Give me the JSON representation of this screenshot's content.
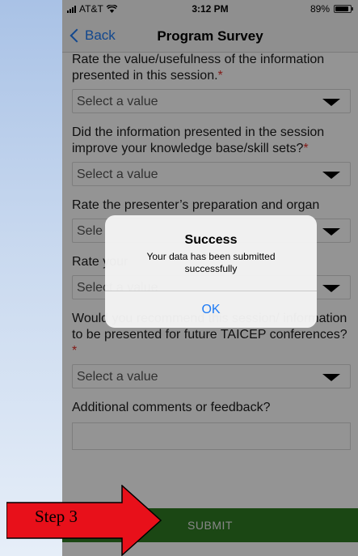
{
  "status_bar": {
    "carrier": "AT&T",
    "time": "3:12 PM",
    "battery": "89%",
    "battery_level": 0.89
  },
  "nav": {
    "back_label": "Back",
    "title": "Program Survey"
  },
  "questions": [
    {
      "text": "Rate the value/usefulness of the information presented in this session.",
      "required_mark": "*",
      "select_value": "Select a value"
    },
    {
      "text": "Did the information presented in the session improve your knowledge base/skill sets?",
      "required_mark": "*",
      "select_value": "Select a value"
    },
    {
      "text": "Rate the presenter’s preparation and organ",
      "required_mark": "",
      "select_value": "Sele"
    },
    {
      "text": "Rate your",
      "required_mark": "",
      "select_value": "Select a value"
    },
    {
      "text": "Would you recommend this session/ information to be presented for future TAICEP conferences?",
      "required_mark": "*",
      "select_value": "Select a value"
    }
  ],
  "comments": {
    "label": "Additional comments or feedback?",
    "value": ""
  },
  "submit_label": "SUBMIT",
  "alert": {
    "title": "Success",
    "message": "Your data has been submitted successfully",
    "ok_label": "OK"
  },
  "callout": {
    "label": "Step 3"
  },
  "colors": {
    "accent": "#1e7bf5",
    "submit_bar": "#2f7a23",
    "required": "#e0302a",
    "callout_fill": "#e8101a"
  }
}
